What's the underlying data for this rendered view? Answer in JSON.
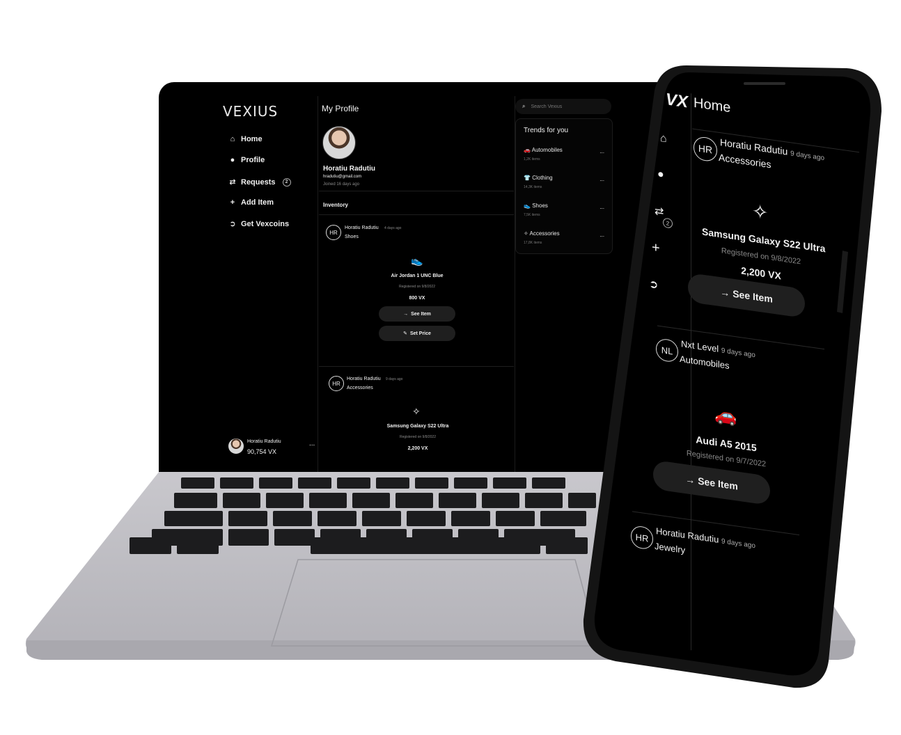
{
  "desktop": {
    "logo": "VEXIUS",
    "nav": [
      {
        "icon": "home-icon",
        "label": "Home"
      },
      {
        "icon": "user-icon",
        "label": "Profile"
      },
      {
        "icon": "exchange-icon",
        "label": "Requests",
        "badge": "2"
      },
      {
        "icon": "plus-icon",
        "label": "Add Item"
      },
      {
        "icon": "arrow-circle-icon",
        "label": "Get Vexcoins"
      }
    ],
    "account": {
      "name": "Horatiu Radutiu",
      "balance": "90,754 VX",
      "more": "..."
    },
    "profile": {
      "header": "My Profile",
      "name": "Horatiu Radutiu",
      "email": "hradutiu@gmail.com",
      "joined": "Joined 16 days ago",
      "inventory_label": "Inventory"
    },
    "posts": [
      {
        "initials": "HR",
        "author": "Horatiu Radutiu",
        "time": "4 days ago",
        "category": "Shoes",
        "item": "Air Jordan 1 UNC Blue",
        "registered": "Registered on 9/8/2022",
        "price": "800 VX",
        "see_item": "See Item",
        "set_price": "Set Price"
      },
      {
        "initials": "HR",
        "author": "Horatiu Radutiu",
        "time": "9 days ago",
        "category": "Accessories",
        "item": "Samsung Galaxy S22 Ultra",
        "registered": "Registered on 9/8/2022",
        "price": "2,200 VX"
      }
    ],
    "search_placeholder": "Search Vexius",
    "trends": {
      "title": "Trends for you",
      "items": [
        {
          "label": "Automobiles",
          "count": "1,2K items",
          "more": "..."
        },
        {
          "label": "Clothing",
          "count": "14,3K items",
          "more": "..."
        },
        {
          "label": "Shoes",
          "count": "7,5K items",
          "more": "..."
        },
        {
          "label": "Accessories",
          "count": "17,8K items",
          "more": "..."
        }
      ]
    }
  },
  "mobile": {
    "logo": "VX",
    "title": "Home",
    "nav_badge": "2",
    "posts": [
      {
        "initials": "HR",
        "author": "Horatiu Radutiu",
        "time": "9 days ago",
        "category": "Accessories",
        "item": "Samsung Galaxy S22 Ultra",
        "registered": "Registered on 9/8/2022",
        "price": "2,200 VX",
        "see_item": "See Item"
      },
      {
        "initials": "NL",
        "author": "Nxt Level",
        "time": "9 days ago",
        "category": "Automobiles",
        "item": "Audi A5 2015",
        "registered": "Registered on 9/7/2022",
        "see_item": "See Item"
      },
      {
        "initials": "HR",
        "author": "Horatiu Radutiu",
        "time": "9 days ago",
        "category": "Jewelry"
      }
    ]
  }
}
